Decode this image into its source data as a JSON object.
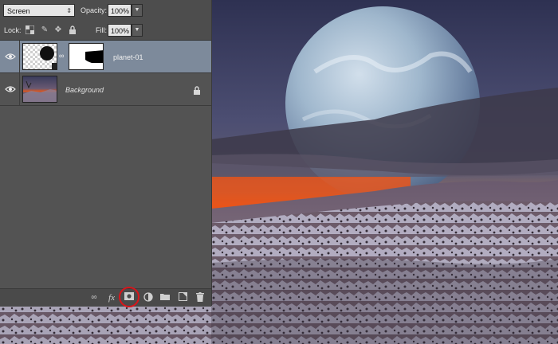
{
  "panel": {
    "blend_mode": "Screen",
    "opacity_label": "Opacity:",
    "opacity_value": "100%",
    "lock_label": "Lock:",
    "fill_label": "Fill:",
    "fill_value": "100%"
  },
  "layers": [
    {
      "name": "planet-01",
      "selected": true,
      "visible": true
    },
    {
      "name": "Background",
      "selected": false,
      "visible": true,
      "locked": true
    }
  ],
  "bottom_icons": [
    "link-layers-icon",
    "fx-icon",
    "add-layer-mask-icon",
    "adjustment-layer-icon",
    "new-group-icon",
    "new-layer-icon",
    "delete-layer-icon"
  ],
  "bottom_fx_label": "fx",
  "highlight_color": "#d8151b"
}
